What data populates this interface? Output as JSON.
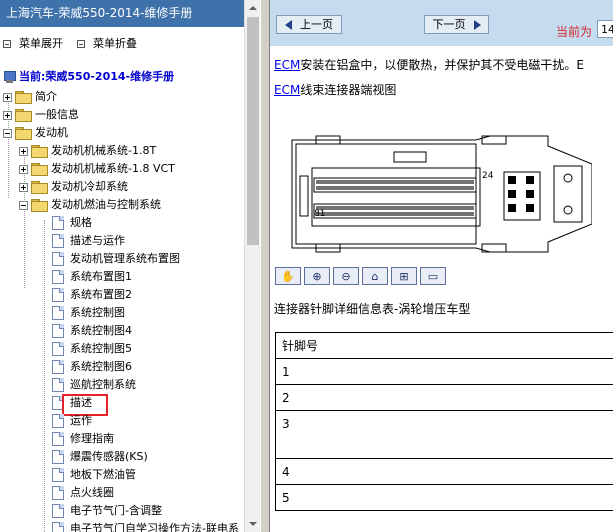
{
  "left": {
    "title": "上海汽车-荣威550-2014-维修手册",
    "menu": {
      "expand": "菜单展开",
      "collapse": "菜单折叠"
    },
    "current": "当前:荣威550-2014-维修手册",
    "tree": [
      {
        "label": "简介",
        "type": "folder",
        "toggle": "plus",
        "level": 0
      },
      {
        "label": "一般信息",
        "type": "folder",
        "toggle": "plus",
        "level": 0
      },
      {
        "label": "发动机",
        "type": "folder",
        "toggle": "minus",
        "level": 0
      },
      {
        "label": "发动机机械系统-1.8T",
        "type": "folder",
        "toggle": "plus",
        "level": 1
      },
      {
        "label": "发动机机械系统-1.8 VCT",
        "type": "folder",
        "toggle": "plus",
        "level": 1
      },
      {
        "label": "发动机冷却系统",
        "type": "folder",
        "toggle": "plus",
        "level": 1
      },
      {
        "label": "发动机燃油与控制系统",
        "type": "folder",
        "toggle": "minus",
        "level": 1
      },
      {
        "label": "规格",
        "type": "page",
        "level": 2
      },
      {
        "label": "描述与运作",
        "type": "page",
        "level": 2
      },
      {
        "label": "发动机管理系统布置图",
        "type": "page",
        "level": 2
      },
      {
        "label": "系统布置图1",
        "type": "page",
        "level": 2
      },
      {
        "label": "系统布置图2",
        "type": "page",
        "level": 2
      },
      {
        "label": "系统控制图",
        "type": "page",
        "level": 2
      },
      {
        "label": "系统控制图4",
        "type": "page",
        "level": 2
      },
      {
        "label": "系统控制图5",
        "type": "page",
        "level": 2
      },
      {
        "label": "系统控制图6",
        "type": "page",
        "level": 2
      },
      {
        "label": "巡航控制系统",
        "type": "page",
        "level": 2
      },
      {
        "label": "描述",
        "type": "page",
        "level": 2,
        "selected": true
      },
      {
        "label": "运作",
        "type": "page",
        "level": 2
      },
      {
        "label": "修理指南",
        "type": "page",
        "level": 2
      },
      {
        "label": "爆震传感器(KS)",
        "type": "page",
        "level": 2
      },
      {
        "label": "地板下燃油管",
        "type": "page",
        "level": 2
      },
      {
        "label": "点火线圈",
        "type": "page",
        "level": 2
      },
      {
        "label": "电子节气门-含调整",
        "type": "page",
        "level": 2
      },
      {
        "label": "电子节气门自学习操作方法-联电系",
        "type": "page",
        "level": 2
      }
    ]
  },
  "right": {
    "nav": {
      "prev": "上一页",
      "next": "下一页",
      "current_label": "当前为",
      "page_value": "14"
    },
    "p1_link": "ECM",
    "p1_text": "安装在铝盒中，以便散热，并保护其不受电磁干扰。E",
    "p2_link": "ECM",
    "p2_text": "线束连接器端视图",
    "connector": {
      "pin_a": "24",
      "pin_b": "81"
    },
    "icons": [
      "hand-icon",
      "zoom-in-icon",
      "zoom-out-icon",
      "home-icon",
      "fit-window-icon",
      "fullscreen-icon"
    ],
    "table_caption": "连接器针脚详细信息表-涡轮增压车型",
    "table": {
      "header": "针脚号",
      "rows": [
        "1",
        "2",
        "3",
        "4",
        "5"
      ]
    }
  }
}
